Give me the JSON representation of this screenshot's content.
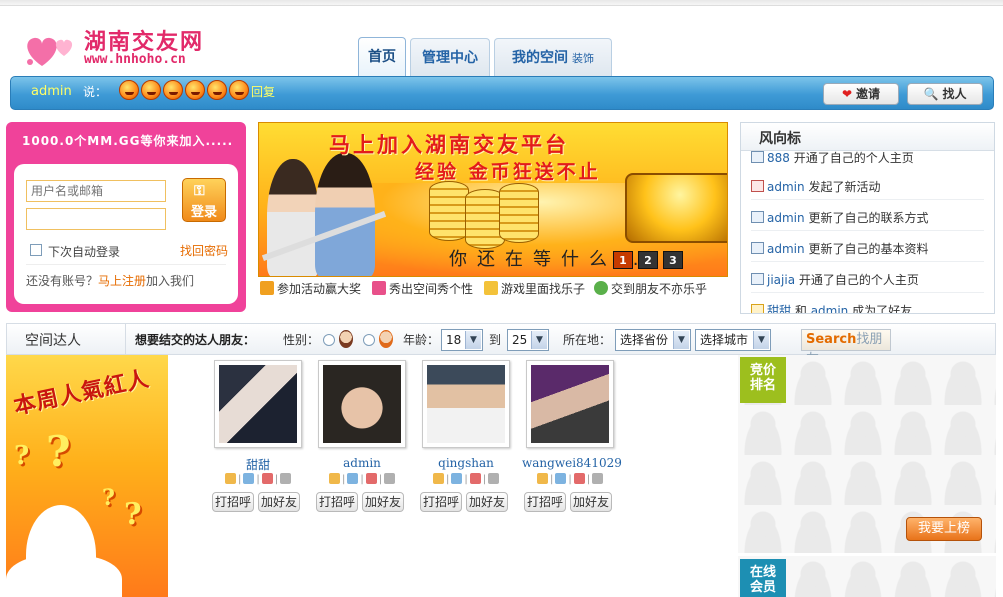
{
  "header": {
    "logo_cn": "湖南交友网",
    "logo_en": "www.hnhoho.cn",
    "tabs": [
      {
        "label": "首页",
        "active": true
      },
      {
        "label": "管理中心",
        "active": false
      },
      {
        "label": "我的空间",
        "sub": "装饰",
        "active": false
      }
    ]
  },
  "userbar": {
    "username": "admin",
    "say_label": "说：",
    "reply_label": "回复",
    "invite_label": "邀请",
    "find_label": "找人"
  },
  "login": {
    "headline": "1000.0个MM.GG等你来加入.....",
    "username_placeholder": "用户名或邮箱",
    "password_value": "",
    "login_button": "登录",
    "remember_label": "下次自动登录",
    "forgot_label": "找回密码",
    "register_prefix": "还没有账号？",
    "register_link": "马上注册",
    "register_suffix": "加入我们"
  },
  "banner": {
    "title": "马上加入湖南交友平台",
    "subtitle": "经验 金币狂送不止",
    "footer": "你还在等什么...",
    "pages": [
      "1",
      "2",
      "3"
    ],
    "active_page": "1",
    "links": [
      {
        "label": "参加活动赢大奖",
        "icon": "gift-icon"
      },
      {
        "label": "秀出空间秀个性",
        "icon": "house-icon"
      },
      {
        "label": "游戏里面找乐子",
        "icon": "game-icon"
      },
      {
        "label": "交到朋友不亦乐乎",
        "icon": "friend-icon"
      }
    ]
  },
  "feed": {
    "title": "风向标",
    "items": [
      {
        "user": "888",
        "text": "开通了自己的个人主页"
      },
      {
        "user": "admin",
        "text": "发起了新活动"
      },
      {
        "user": "admin",
        "text": "更新了自己的联系方式"
      },
      {
        "user": "admin",
        "text": "更新了自己的基本资料"
      },
      {
        "user": "jiajia",
        "text": "开通了自己的个人主页"
      },
      {
        "user": "甜甜",
        "mid": "和",
        "user2": "admin",
        "text": "成为了好友"
      }
    ]
  },
  "filter": {
    "section_title": "空间达人",
    "question": "想要结交的达人朋友：",
    "sex_label": "性别：",
    "age_label": "年龄：",
    "age_from": "18",
    "to_label": "到",
    "age_to": "25",
    "location_label": "所在地：",
    "province": "选择省份",
    "city": "选择城市",
    "search_word": "Search",
    "search_label": "找朋友"
  },
  "popular": {
    "title": "本周人氣紅人"
  },
  "members": [
    {
      "name": "甜甜",
      "greet": "打招呼",
      "add": "加好友"
    },
    {
      "name": "admin",
      "greet": "打招呼",
      "add": "加好友"
    },
    {
      "name": "qingshan",
      "greet": "打招呼",
      "add": "加好友"
    },
    {
      "name": "wangwei841029",
      "greet": "打招呼",
      "add": "加好友"
    }
  ],
  "ranking": {
    "tag": "竞价排名",
    "button": "我要上榜",
    "online_tag": "在线会员"
  },
  "colors": {
    "brand_pink": "#f0429a",
    "accent_blue": "#2f8bc9",
    "link_blue": "#2463a6",
    "orange": "#e66b00"
  }
}
